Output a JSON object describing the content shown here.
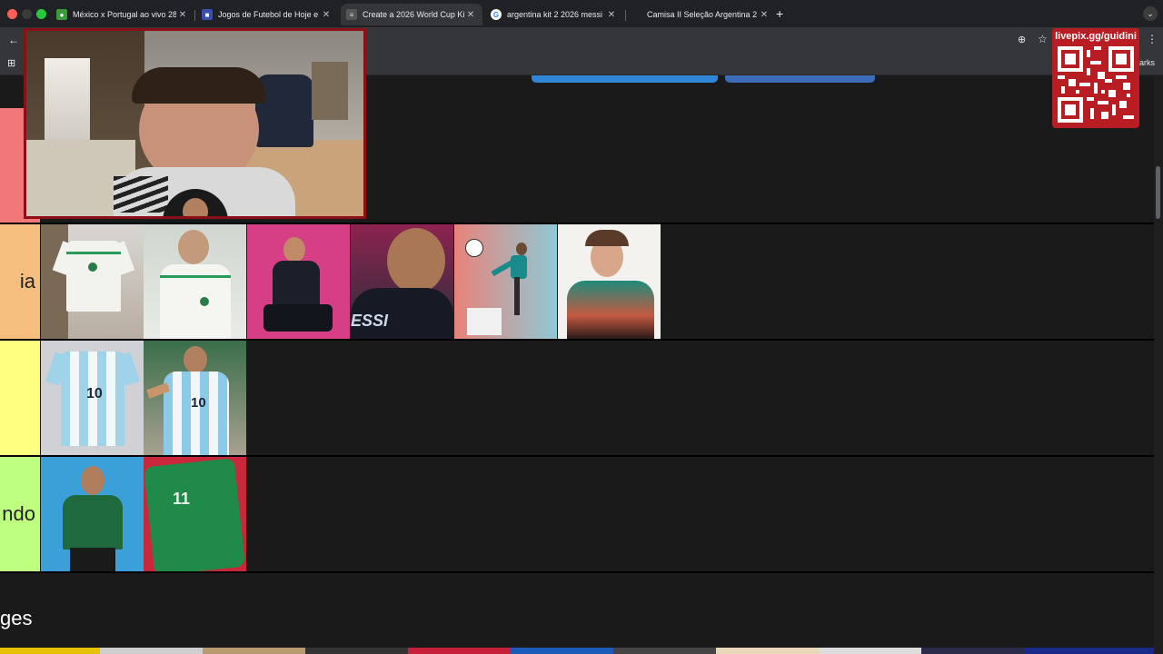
{
  "tabs": [
    {
      "label": "México x Portugal ao vivo 28/",
      "active": false,
      "favicon": "green-globe-icon"
    },
    {
      "label": "Jogos de Futebol de Hoje e F",
      "active": false,
      "favicon": "blue-square-icon"
    },
    {
      "label": "Create a 2026 World Cup Kit",
      "active": true,
      "favicon": "tiermaker-icon"
    },
    {
      "label": "argentina kit 2 2026 messi - I",
      "active": false,
      "favicon": "google-icon"
    },
    {
      "label": "Camisa II Seleção Argentina 2",
      "active": false,
      "favicon": "none"
    }
  ],
  "bookmarks_tail": "arks",
  "tiers": [
    {
      "label": "",
      "color": "#f2777a",
      "tiles": []
    },
    {
      "label": "ia",
      "color": "#f7bf7f",
      "tiles": [
        "algeria-white-kit-hanging",
        "algeria-white-kit-player",
        "argentina-black-kit-player-pink",
        "messi-black-kit-closeup",
        "player-kicking-ball-teal",
        "player-teal-nike-kit"
      ]
    },
    {
      "label": "",
      "color": "#ffff7f",
      "tiles": [
        "argentina-home-kit-10",
        "messi-argentina-home-kit"
      ]
    },
    {
      "label": "ndo",
      "color": "#bfff7f",
      "tiles": [
        "algeria-green-kit-player",
        "algeria-green-kit-11"
      ]
    }
  ],
  "section_title": "ges",
  "livepix": {
    "text": "livepix.gg/guidini"
  },
  "colors": {
    "tab_bg": "#202124",
    "toolbar_bg": "#35363a",
    "page_bg": "#1a1a1a",
    "pill_left": "#2f86d6",
    "pill_right": "#3d6bb8",
    "livepix_red": "#b81d24"
  }
}
